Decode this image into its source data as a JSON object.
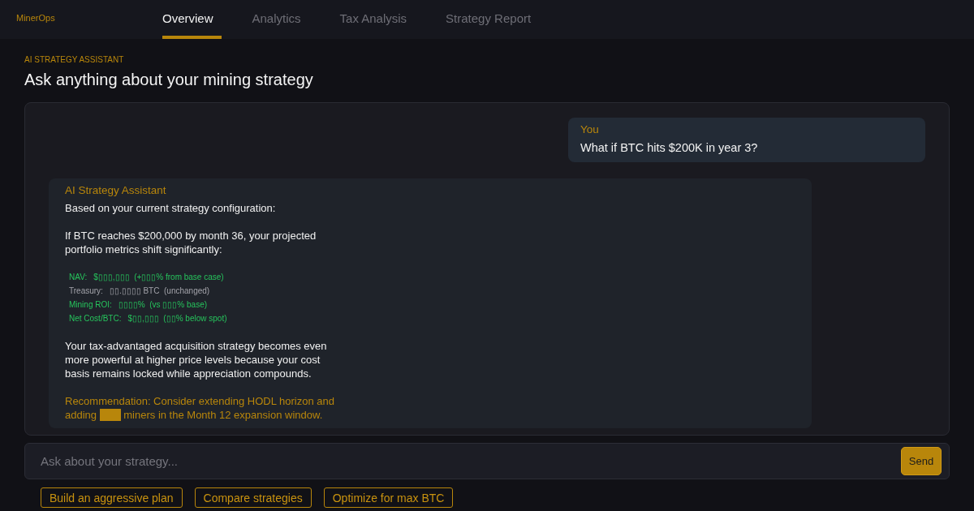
{
  "nav": {
    "logo": "MinerOps",
    "tabs": [
      {
        "label": "Overview",
        "selected": true
      },
      {
        "label": "Analytics",
        "selected": false
      },
      {
        "label": "Tax Analysis",
        "selected": false
      },
      {
        "label": "Strategy Report",
        "selected": false
      }
    ]
  },
  "header": {
    "eyebrow": "AI STRATEGY ASSISTANT",
    "title": "Ask anything about your mining strategy"
  },
  "messages": [
    {
      "kind": "user",
      "sender": "You",
      "text": "What if BTC hits $200K in year 3?"
    },
    {
      "kind": "assistant",
      "sender": "AI Strategy Assistant",
      "blocks": [
        {
          "kind": "text",
          "text": "Based on your current strategy configuration:"
        },
        {
          "kind": "text",
          "text": "If BTC reaches $200,000 by month 36, your projected portfolio metrics shift significantly:"
        },
        {
          "kind": "metrics",
          "items": [
            {
              "label": "NAV:",
              "value": "$▯▯▯,▯▯▯  (+▯▯▯% from base case)",
              "changed": true
            },
            {
              "label": "Treasury:",
              "value": "▯▯.▯▯▯▯ BTC  (unchanged)",
              "changed": false
            },
            {
              "label": "Mining ROI:",
              "value": "▯▯▯▯%  (vs ▯▯▯% base)",
              "changed": true
            },
            {
              "label": "Net Cost/BTC:",
              "value": "$▯▯,▯▯▯  (▯▯% below spot)",
              "changed": true
            }
          ]
        },
        {
          "kind": "text",
          "text": "Your tax-advantaged acquisition strategy becomes even more powerful at higher price levels because your cost basis remains locked while appreciation compounds."
        },
        {
          "kind": "recommendation",
          "before": "Recommendation: Consider extending HODL horizon and adding",
          "redacted": true,
          "after": "miners in the Month 12 expansion window."
        }
      ]
    }
  ],
  "composer": {
    "placeholder": "Ask about your strategy...",
    "send": "Send"
  },
  "suggestions": [
    "Build an aggressive plan",
    "Compare strategies",
    "Optimize for max BTC"
  ]
}
